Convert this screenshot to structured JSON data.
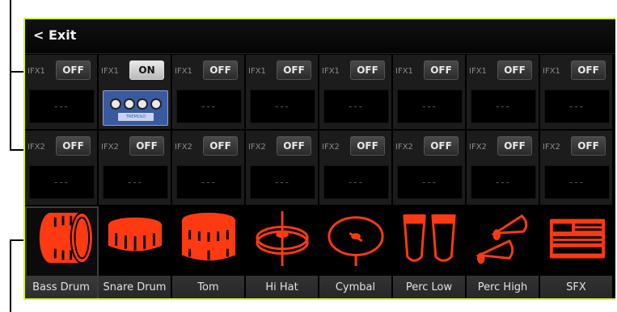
{
  "header": {
    "exit_label": "< Exit"
  },
  "row1": [
    {
      "label": "IFX1",
      "state": "OFF",
      "slot": "---"
    },
    {
      "label": "IFX1",
      "state": "ON",
      "slot": "pedal"
    },
    {
      "label": "IFX1",
      "state": "OFF",
      "slot": "---"
    },
    {
      "label": "IFX1",
      "state": "OFF",
      "slot": "---"
    },
    {
      "label": "IFX1",
      "state": "OFF",
      "slot": "---"
    },
    {
      "label": "IFX1",
      "state": "OFF",
      "slot": "---"
    },
    {
      "label": "IFX1",
      "state": "OFF",
      "slot": "---"
    },
    {
      "label": "IFX1",
      "state": "OFF",
      "slot": "---"
    }
  ],
  "row2": [
    {
      "label": "IFX2",
      "state": "OFF",
      "slot": "---"
    },
    {
      "label": "IFX2",
      "state": "OFF",
      "slot": "---"
    },
    {
      "label": "IFX2",
      "state": "OFF",
      "slot": "---"
    },
    {
      "label": "IFX2",
      "state": "OFF",
      "slot": "---"
    },
    {
      "label": "IFX2",
      "state": "OFF",
      "slot": "---"
    },
    {
      "label": "IFX2",
      "state": "OFF",
      "slot": "---"
    },
    {
      "label": "IFX2",
      "state": "OFF",
      "slot": "---"
    },
    {
      "label": "IFX2",
      "state": "OFF",
      "slot": "---"
    }
  ],
  "kits": [
    {
      "label": "Bass Drum",
      "icon": "bass-drum-icon"
    },
    {
      "label": "Snare Drum",
      "icon": "snare-drum-icon"
    },
    {
      "label": "Tom",
      "icon": "tom-icon"
    },
    {
      "label": "Hi Hat",
      "icon": "hi-hat-icon"
    },
    {
      "label": "Cymbal",
      "icon": "cymbal-icon"
    },
    {
      "label": "Perc Low",
      "icon": "congas-icon"
    },
    {
      "label": "Perc High",
      "icon": "shakers-icon"
    },
    {
      "label": "SFX",
      "icon": "drum-machine-icon"
    }
  ],
  "selected_kit_index": 0,
  "colors": {
    "accent": "#ff3a12",
    "frame": "#d7ef3a"
  },
  "pedal_text": "TREMOLO"
}
